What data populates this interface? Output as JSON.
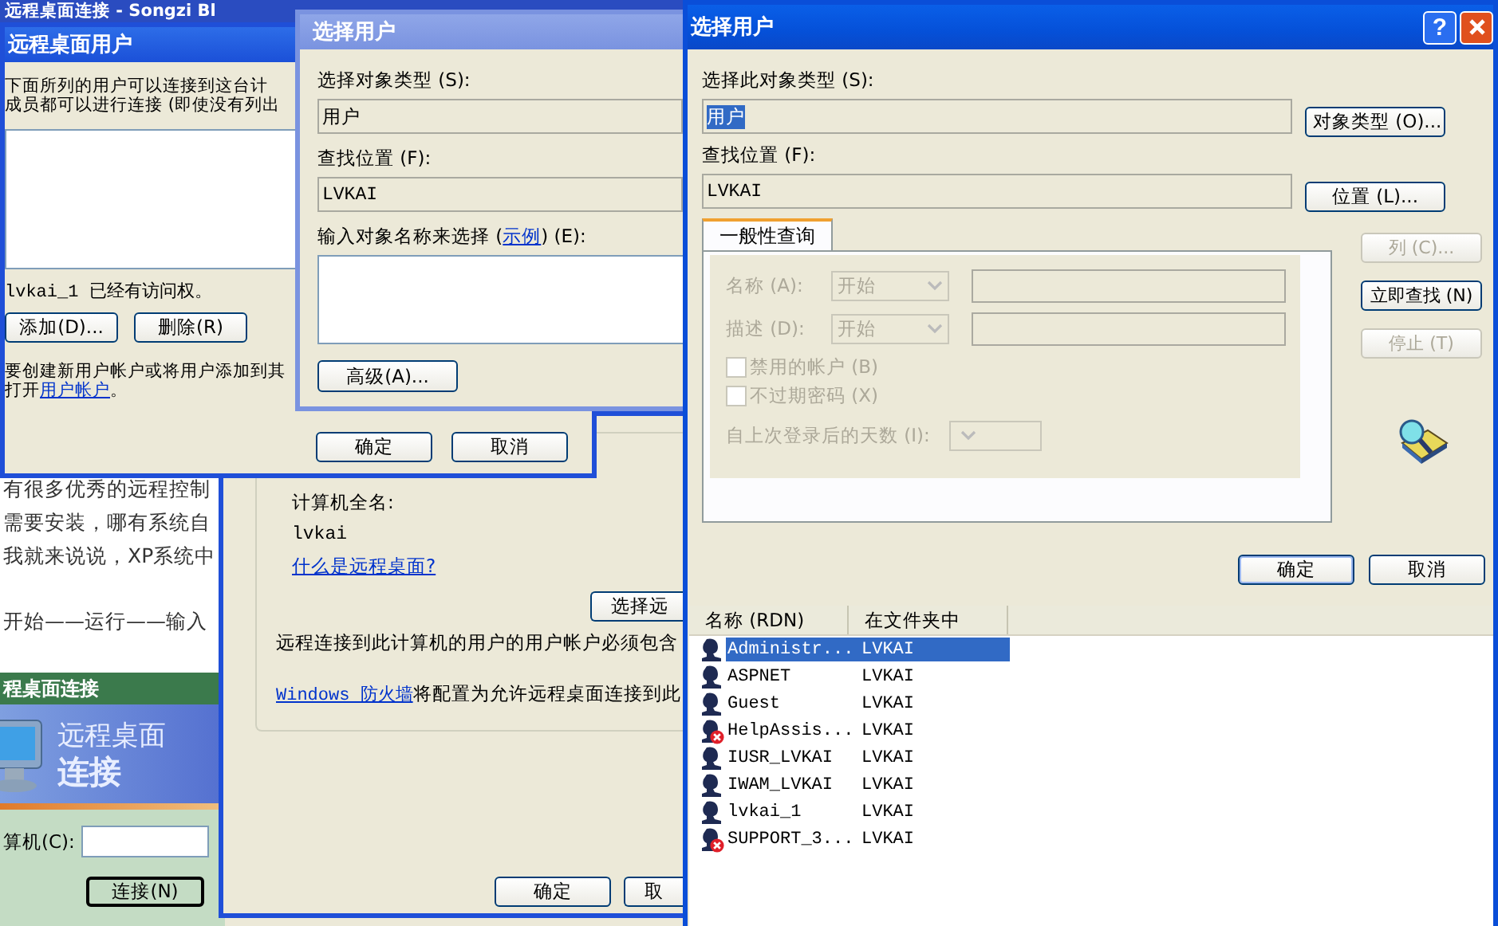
{
  "browser": {
    "title": "远程桌面连接 - Songzi Bl",
    "article_lines": [
      "有很多优秀的远程控制",
      "需要安装，哪有系统自",
      "我就来说说，XP系统中",
      "开始——运行——输入"
    ]
  },
  "rdp_client": {
    "title": "程桌面连接",
    "banner_line1": "远程桌面",
    "banner_line2": "连接",
    "computer_label": "算机(C):",
    "connect_button": "连接(N)"
  },
  "system_properties": {
    "full_name_label": "计算机全名:",
    "full_name": "lvkai",
    "help_link": "什么是远程桌面?",
    "select_button": "选择远",
    "account_note": "远程连接到此计算机的用户的用户帐户必须包含",
    "firewall_link": "Windows 防火墙",
    "firewall_text": "将配置为允许远程桌面连接到此",
    "ok_button": "确定",
    "cancel_button": "取"
  },
  "remote_users": {
    "title": "远程桌面用户",
    "intro_lines": [
      "下面所列的用户可以连接到这台计",
      "成员都可以进行连接 (即使没有列出"
    ],
    "access_note": "lvkai_1 已经有访问权。",
    "add_button": "添加(D)...",
    "remove_button": "删除(R)",
    "hint_line": "要创建新用户帐户或将用户添加到其",
    "open_prefix": "打开",
    "accounts_link": "用户帐户",
    "open_suffix": "。",
    "ok_button": "确定",
    "cancel_button": "取消"
  },
  "select_users_small": {
    "title": "选择用户",
    "object_type_label": "选择对象类型 (S):",
    "object_type": "用户",
    "location_label": "查找位置 (F):",
    "location": "LVKAI",
    "names_label_prefix": "输入对象名称来选择 (",
    "example_link": "示例",
    "names_label_suffix": ") (E):",
    "advanced_button": "高级(A)..."
  },
  "select_users": {
    "title": "选择用户",
    "help_button": "?",
    "object_type_label": "选择此对象类型 (S):",
    "object_type": "用户",
    "object_type_button": "对象类型 (O)...",
    "location_label": "查找位置 (F):",
    "location": "LVKAI",
    "location_button": "位置 (L)...",
    "tab": {
      "label": "一般性查询",
      "selected": true
    },
    "query": {
      "enabled": false,
      "name_label": "名称 (A):",
      "name_match": "开始",
      "desc_label": "描述 (D):",
      "desc_match": "开始",
      "checks": [
        {
          "label": "禁用的帐户 (B)",
          "checked": false
        },
        {
          "label": "不过期密码 (X)",
          "checked": false
        }
      ],
      "days_label": "自上次登录后的天数 (I):"
    },
    "side_buttons": [
      {
        "label": "列 (C)...",
        "disabled": true
      },
      {
        "label": "立即查找 (N)",
        "disabled": false
      },
      {
        "label": "停止 (T)",
        "disabled": true
      }
    ],
    "ok_button": "确定",
    "cancel_button": "取消",
    "results": {
      "columns": [
        "名称 (RDN)",
        "在文件夹中"
      ],
      "rows": [
        {
          "name": "Administr...",
          "folder": "LVKAI",
          "disabled_account": false,
          "selected": true
        },
        {
          "name": "ASPNET",
          "folder": "LVKAI",
          "disabled_account": false,
          "selected": false
        },
        {
          "name": "Guest",
          "folder": "LVKAI",
          "disabled_account": false,
          "selected": false
        },
        {
          "name": "HelpAssis...",
          "folder": "LVKAI",
          "disabled_account": true,
          "selected": false
        },
        {
          "name": "IUSR_LVKAI",
          "folder": "LVKAI",
          "disabled_account": false,
          "selected": false
        },
        {
          "name": "IWAM_LVKAI",
          "folder": "LVKAI",
          "disabled_account": false,
          "selected": false
        },
        {
          "name": "lvkai_1",
          "folder": "LVKAI",
          "disabled_account": false,
          "selected": false
        },
        {
          "name": "SUPPORT_3...",
          "folder": "LVKAI",
          "disabled_account": true,
          "selected": false
        }
      ]
    }
  }
}
